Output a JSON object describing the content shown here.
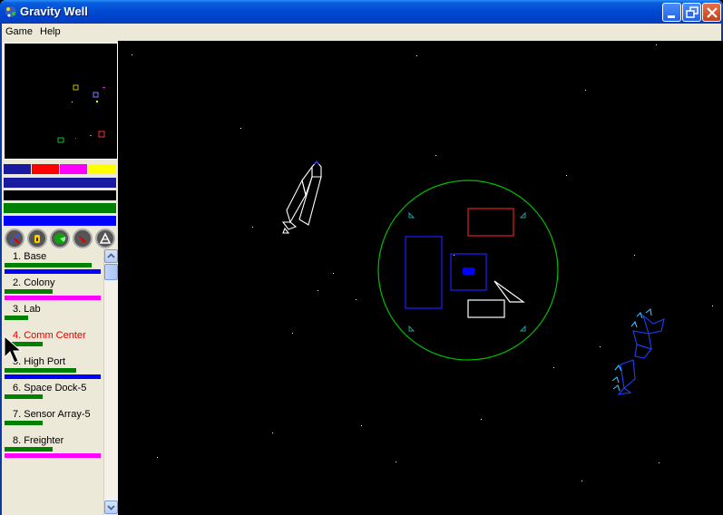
{
  "window": {
    "title": "Gravity Well"
  },
  "menu": {
    "items": [
      "Game",
      "Help"
    ]
  },
  "colors": {
    "player_blue": "#1a1aa0",
    "player_red": "#ff0000",
    "player_magenta": "#ff00ff",
    "player_yellow": "#ffff00",
    "health_green": "#008000",
    "shield_blue": "#0000ff",
    "range_circle": "#00c000"
  },
  "status_bars": {
    "color_swatches": [
      "#1a1aa0",
      "#ff0000",
      "#ff00ff",
      "#ffff00"
    ],
    "bars": [
      "#1a1aa0",
      "#000000",
      "#008000",
      "#0000ff"
    ]
  },
  "tool_icons": [
    "navigate-icon",
    "lock-icon",
    "radar-icon",
    "attack-icon",
    "build-icon"
  ],
  "units": [
    {
      "label": "1. Base",
      "health": 0.88,
      "shield_color": "#0000ff",
      "shield": 0.98,
      "active": false
    },
    {
      "label": "2. Colony",
      "health": 0.48,
      "shield_color": "#ff00ff",
      "shield": 0.98,
      "active": false
    },
    {
      "label": "3. Lab",
      "health": 0.24,
      "shield_color": "",
      "shield": 0,
      "active": false
    },
    {
      "label": "4. Comm Center",
      "health": 0.38,
      "shield_color": "",
      "shield": 0,
      "active": true
    },
    {
      "label": "5. High Port",
      "health": 0.72,
      "shield_color": "#0000ff",
      "shield": 0.98,
      "active": false
    },
    {
      "label": "6. Space Dock-5",
      "health": 0.38,
      "shield_color": "",
      "shield": 0,
      "active": false
    },
    {
      "label": "7. Sensor Array-5",
      "health": 0.38,
      "shield_color": "",
      "shield": 0,
      "active": false
    },
    {
      "label": "8. Freighter",
      "health": 0.48,
      "shield_color": "#ff00ff",
      "shield": 0.98,
      "active": false
    }
  ]
}
